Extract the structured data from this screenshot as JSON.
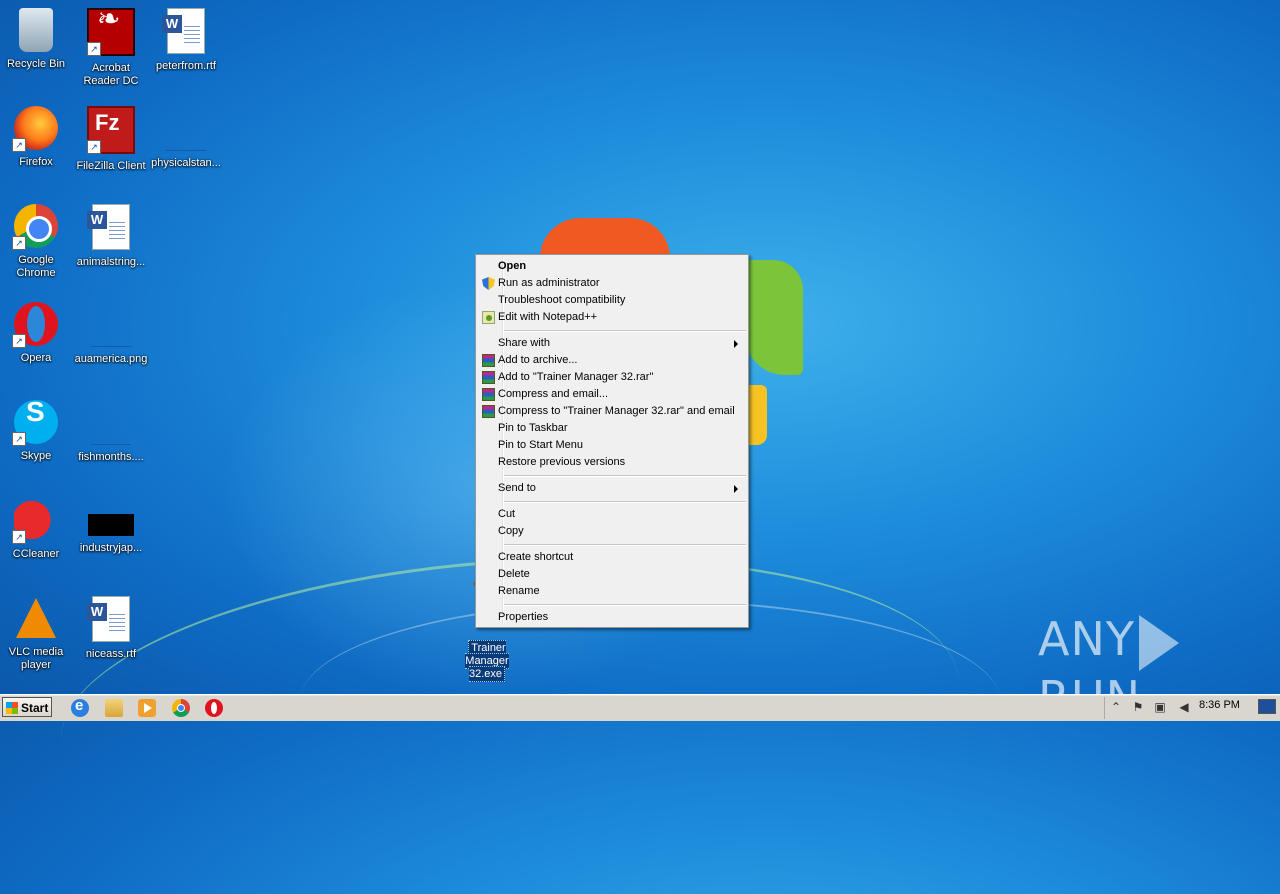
{
  "desktop": {
    "icons": [
      {
        "label": "Recycle Bin"
      },
      {
        "label": "Acrobat Reader DC"
      },
      {
        "label": "peterfrom.rtf"
      },
      {
        "label": "Firefox"
      },
      {
        "label": "FileZilla Client"
      },
      {
        "label": "physicalstan..."
      },
      {
        "label": "Google Chrome"
      },
      {
        "label": "animalstring..."
      },
      {
        "label": "Opera"
      },
      {
        "label": "auamerica.png"
      },
      {
        "label": "Skype"
      },
      {
        "label": "fishmonths...."
      },
      {
        "label": "CCleaner"
      },
      {
        "label": "industryjap..."
      },
      {
        "label": "VLC media player"
      },
      {
        "label": "niceass.rtf"
      }
    ],
    "selected_icon": {
      "label": "Trainer Manager 32.exe"
    }
  },
  "context_menu": {
    "items": [
      {
        "label": "Open",
        "icon": null
      },
      {
        "label": "Run as administrator",
        "icon": "uac-shield-icon"
      },
      {
        "label": "Troubleshoot compatibility",
        "icon": null
      },
      {
        "label": "Edit with Notepad++",
        "icon": "notepadpp-icon"
      },
      {
        "label": "Share with",
        "submenu": true
      },
      {
        "label": "Add to archive...",
        "icon": "winrar-icon"
      },
      {
        "label": "Add to \"Trainer Manager 32.rar\"",
        "icon": "winrar-icon"
      },
      {
        "label": "Compress and email...",
        "icon": "winrar-icon"
      },
      {
        "label": "Compress to \"Trainer Manager 32.rar\" and email",
        "icon": "winrar-icon"
      },
      {
        "label": "Pin to Taskbar"
      },
      {
        "label": "Pin to Start Menu"
      },
      {
        "label": "Restore previous versions"
      },
      {
        "label": "Send to",
        "submenu": true
      },
      {
        "label": "Cut"
      },
      {
        "label": "Copy"
      },
      {
        "label": "Create shortcut"
      },
      {
        "label": "Delete"
      },
      {
        "label": "Rename"
      },
      {
        "label": "Properties"
      }
    ]
  },
  "taskbar": {
    "start_label": "Start",
    "pinned": [
      "internet-explorer-icon",
      "explorer-icon",
      "media-player-icon",
      "chrome-icon",
      "opera-icon"
    ],
    "clock": "8:36 PM"
  },
  "watermark": {
    "text_left": "ANY",
    "text_right": "RUN"
  },
  "colors": {
    "desktop_blue": "#1f8fdd",
    "menu_bg": "#f0f0f0",
    "taskbar_bg": "#d8d6cf"
  }
}
